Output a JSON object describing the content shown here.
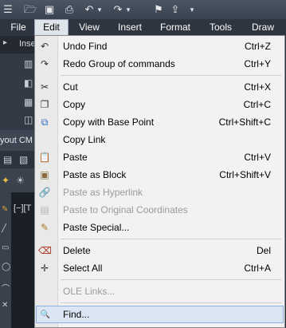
{
  "quick_access": {
    "icons": [
      "hamburger-icon",
      "open-icon",
      "save-icon",
      "print-icon",
      "undo-icon",
      "dropdown-arrow-icon",
      "redo-icon",
      "dropdown-arrow-icon",
      "pin-icon",
      "share-icon",
      "dropdown-arrow-icon"
    ]
  },
  "menubar": {
    "items": [
      "File",
      "Edit",
      "View",
      "Insert",
      "Format",
      "Tools",
      "Draw"
    ],
    "active": "Edit"
  },
  "background": {
    "tab_fragment": "Inse",
    "layout_fragment": "yout CM",
    "viewport_fragment": "[−][T"
  },
  "edit_menu": {
    "items": [
      {
        "label": "Undo Find",
        "shortcut": "Ctrl+Z",
        "icon": "undo-icon",
        "enabled": true
      },
      {
        "label": "Redo Group of commands",
        "shortcut": "Ctrl+Y",
        "icon": "redo-icon",
        "enabled": true
      },
      {
        "label": "Cut",
        "shortcut": "Ctrl+X",
        "icon": "scissors-icon",
        "enabled": true
      },
      {
        "label": "Copy",
        "shortcut": "Ctrl+C",
        "icon": "copy-icon",
        "enabled": true
      },
      {
        "label": "Copy with Base Point",
        "shortcut": "Ctrl+Shift+C",
        "icon": "copy-base-point-icon",
        "enabled": true
      },
      {
        "label": "Copy Link",
        "shortcut": "",
        "icon": "",
        "enabled": true
      },
      {
        "label": "Paste",
        "shortcut": "Ctrl+V",
        "icon": "paste-icon",
        "enabled": true
      },
      {
        "label": "Paste as Block",
        "shortcut": "Ctrl+Shift+V",
        "icon": "paste-block-icon",
        "enabled": true
      },
      {
        "label": "Paste as Hyperlink",
        "shortcut": "",
        "icon": "paste-hyperlink-icon",
        "enabled": false
      },
      {
        "label": "Paste to Original Coordinates",
        "shortcut": "",
        "icon": "paste-original-icon",
        "enabled": false
      },
      {
        "label": "Paste Special...",
        "shortcut": "",
        "icon": "paste-special-icon",
        "enabled": true
      },
      {
        "label": "Delete",
        "shortcut": "Del",
        "icon": "eraser-icon",
        "enabled": true
      },
      {
        "label": "Select All",
        "shortcut": "Ctrl+A",
        "icon": "select-all-icon",
        "enabled": true
      },
      {
        "label": "OLE Links...",
        "shortcut": "",
        "icon": "",
        "enabled": false
      },
      {
        "label": "Find...",
        "shortcut": "",
        "icon": "find-icon",
        "enabled": true,
        "highlighted": true
      }
    ]
  },
  "colors": {
    "menu_bg": "#f2f2f2",
    "highlight": "#dbe6f5",
    "disabled_text": "#9a9a9a",
    "app_dark": "#2e3540"
  }
}
